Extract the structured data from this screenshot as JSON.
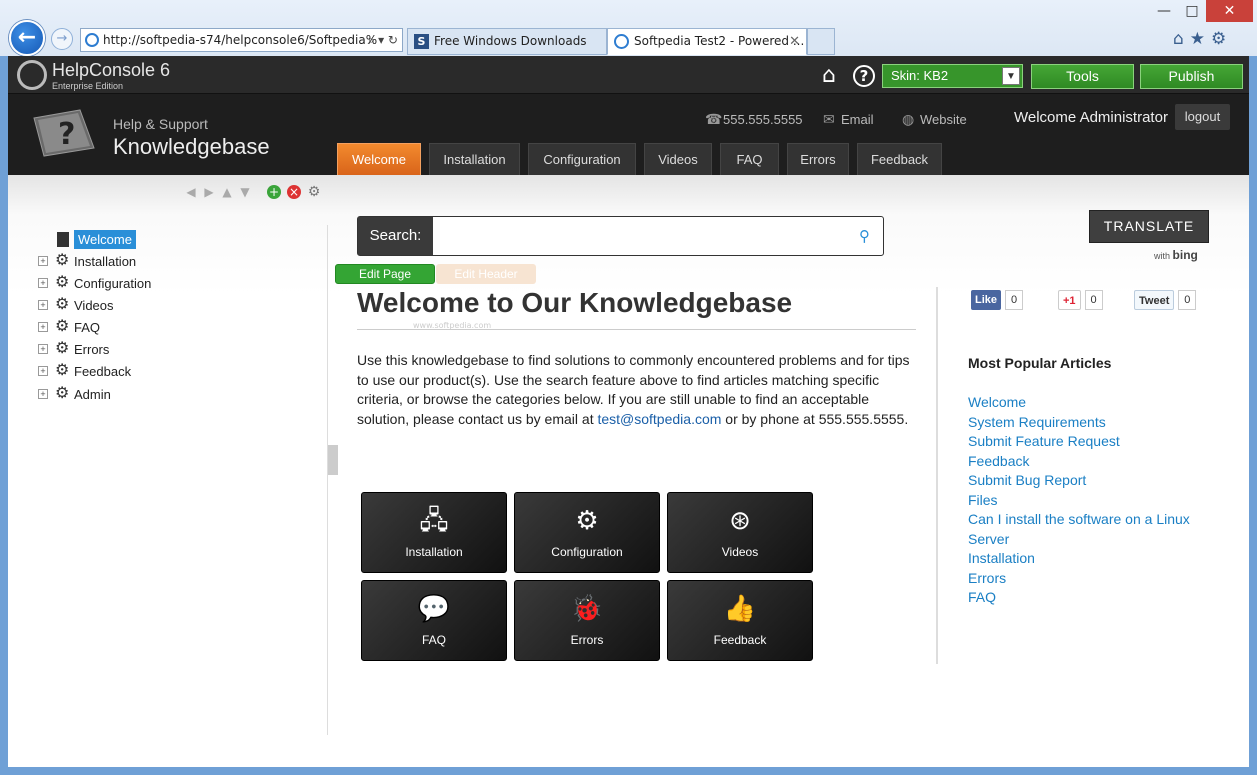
{
  "browser": {
    "address": "http://softpedia-s74/helpconsole6/Softpedia%",
    "tabs": [
      {
        "title": "Free Windows Downloads"
      },
      {
        "title": "Softpedia Test2 - Powered ..."
      }
    ],
    "window_controls": {
      "minimize": "—",
      "maximize": "□",
      "close": "✕"
    }
  },
  "app": {
    "name": "HelpConsole 6",
    "edition": "Enterprise Edition",
    "skin_label": "Skin: KB2",
    "tools_label": "Tools",
    "publish_label": "Publish"
  },
  "header": {
    "subtitle": "Help & Support",
    "title": "Knowledgebase",
    "phone": "555.555.5555",
    "email": "Email",
    "website": "Website",
    "welcome": "Welcome Administrator",
    "logout": "logout"
  },
  "nav": [
    "Welcome",
    "Installation",
    "Configuration",
    "Videos",
    "FAQ",
    "Errors",
    "Feedback"
  ],
  "tree": [
    "Welcome",
    "Installation",
    "Configuration",
    "Videos",
    "FAQ",
    "Errors",
    "Feedback",
    "Admin"
  ],
  "search": {
    "label": "Search:",
    "placeholder": ""
  },
  "edit": {
    "page": "Edit Page",
    "header": "Edit Header"
  },
  "content": {
    "heading": "Welcome to Our Knowledgebase",
    "watermark": "www.softpedia.com",
    "para_before": "Use this knowledgebase to find solutions to commonly encountered problems and for tips to use our product(s). Use the search feature above to find articles matching specific criteria, or browse the categories below. If you are still unable to find an acceptable solution, please contact us by email at ",
    "email_link": "test@softpedia.com",
    "para_after": " or by phone at 555.555.5555."
  },
  "tiles": [
    "Installation",
    "Configuration",
    "Videos",
    "FAQ",
    "Errors",
    "Feedback"
  ],
  "translate": {
    "label": "TRANSLATE",
    "with": "with",
    "bing": "bing"
  },
  "social": {
    "facebook": {
      "label": "Like",
      "count": "0"
    },
    "google": {
      "label": "+1",
      "count": "0"
    },
    "twitter": {
      "label": "Tweet",
      "count": "0"
    }
  },
  "popular": {
    "title": "Most Popular Articles",
    "items": [
      "Welcome",
      "System Requirements",
      "Submit Feature Request",
      "Feedback",
      "Submit Bug Report",
      "Files",
      "Can I install the software on a Linux Server",
      "Installation",
      "Errors",
      "FAQ"
    ]
  },
  "colors": {
    "accent_orange": "#e0711f",
    "green": "#37952b",
    "link": "#1a7fc4"
  }
}
